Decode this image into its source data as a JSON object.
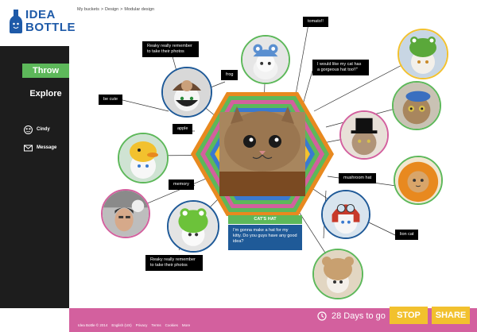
{
  "brand": {
    "line1": "IDEA",
    "line2": "BOTTLE",
    "color": "#1e5aa8"
  },
  "breadcrumb": [
    "My buckets",
    ">",
    "Design",
    ">",
    "Modular design"
  ],
  "sidebar": {
    "throw_label": "Throw",
    "explore_label": "Explore",
    "user_name": "Cindy",
    "message_label": "Message",
    "accent": "#5db85a"
  },
  "tags": {
    "tomato": "tomato!!",
    "reaky_top": "Reaky really remember to take their photos",
    "frog": "frog",
    "gorgeous": "I would like my cat has a gorgeous hat too!!\"",
    "be_cute": "be cute",
    "apple": "apple",
    "mushroom": "mushroom hat",
    "memory": "memory",
    "lion": "lion cat",
    "reaky_bottom": "Reaky really remember to take their photos"
  },
  "center": {
    "title": "CAT'S HAT",
    "question": "I'm gonna make a hat for my kitty. Do you guys have any good idea?"
  },
  "footer": {
    "timer": "28 Days to go",
    "stop_label": "STOP",
    "share_label": "SHARE",
    "links": [
      "Idea Bottle © 2014",
      "English (US)",
      "Privacy",
      "Terms",
      "Cookies",
      "More"
    ],
    "bar_color": "#d3609e",
    "button_color": "#f2c12e"
  },
  "colors": {
    "green": "#5db85a",
    "pink": "#d3609e",
    "blue": "#1f5a98",
    "yellow": "#f2c12e",
    "orange": "#e8891f",
    "sidebar": "#1d1d1d"
  }
}
